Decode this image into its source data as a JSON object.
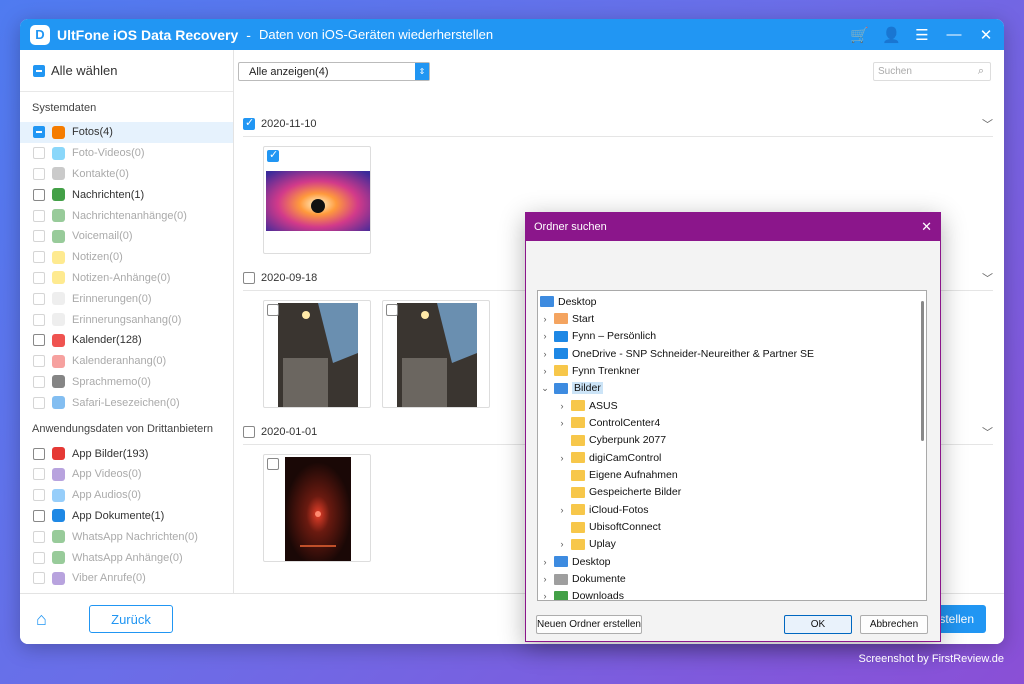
{
  "window": {
    "app_name": "UltFone iOS Data Recovery",
    "separator": "-",
    "subtitle": "Daten von iOS-Geräten wiederherstellen",
    "logo_letter": "D"
  },
  "sidebar": {
    "select_all": "Alle wählen",
    "section1_title": "Systemdaten",
    "section1_items": [
      {
        "label": "Fotos(4)",
        "state": "partial",
        "enabled": true,
        "active": true,
        "color": "#f57c00"
      },
      {
        "label": "Foto-Videos(0)",
        "state": "none",
        "enabled": false,
        "color": "#29b6f6"
      },
      {
        "label": "Kontakte(0)",
        "state": "none",
        "enabled": false,
        "color": "#9e9e9e"
      },
      {
        "label": "Nachrichten(1)",
        "state": "none",
        "enabled": true,
        "color": "#43a047"
      },
      {
        "label": "Nachrichtenanhänge(0)",
        "state": "none",
        "enabled": false,
        "color": "#43a047"
      },
      {
        "label": "Voicemail(0)",
        "state": "none",
        "enabled": false,
        "color": "#43a047"
      },
      {
        "label": "Notizen(0)",
        "state": "none",
        "enabled": false,
        "color": "#fdd835"
      },
      {
        "label": "Notizen-Anhänge(0)",
        "state": "none",
        "enabled": false,
        "color": "#fdd835"
      },
      {
        "label": "Erinnerungen(0)",
        "state": "none",
        "enabled": false,
        "color": "#e0e0e0"
      },
      {
        "label": "Erinnerungsanhang(0)",
        "state": "none",
        "enabled": false,
        "color": "#e0e0e0"
      },
      {
        "label": "Kalender(128)",
        "state": "none",
        "enabled": true,
        "color": "#ef5350"
      },
      {
        "label": "Kalenderanhang(0)",
        "state": "none",
        "enabled": false,
        "color": "#ef5350"
      },
      {
        "label": "Sprachmemo(0)",
        "state": "none",
        "enabled": false,
        "color": "#212121"
      },
      {
        "label": "Safari-Lesezeichen(0)",
        "state": "none",
        "enabled": false,
        "color": "#1e88e5"
      }
    ],
    "section2_title": "Anwendungsdaten von Drittanbietern",
    "section2_items": [
      {
        "label": "App Bilder(193)",
        "state": "none",
        "enabled": true,
        "color": "#e53935"
      },
      {
        "label": "App Videos(0)",
        "state": "none",
        "enabled": false,
        "color": "#7e57c2"
      },
      {
        "label": "App Audios(0)",
        "state": "none",
        "enabled": false,
        "color": "#42a5f5"
      },
      {
        "label": "App Dokumente(1)",
        "state": "none",
        "enabled": true,
        "color": "#1e88e5"
      },
      {
        "label": "WhatsApp Nachrichten(0)",
        "state": "none",
        "enabled": false,
        "color": "#43a047"
      },
      {
        "label": "WhatsApp Anhänge(0)",
        "state": "none",
        "enabled": false,
        "color": "#43a047"
      },
      {
        "label": "Viber Anrufe(0)",
        "state": "none",
        "enabled": false,
        "color": "#7e57c2"
      }
    ]
  },
  "toolbar": {
    "filter_value": "Alle anzeigen(4)",
    "search_placeholder": "Suchen"
  },
  "groups": [
    {
      "date": "2020-11-10",
      "checked": true
    },
    {
      "date": "2020-09-18",
      "checked": false
    },
    {
      "date": "2020-01-01",
      "checked": false
    }
  ],
  "footer": {
    "back_label": "Zurück",
    "restore_label": "stellen"
  },
  "dialog": {
    "title": "Ordner suchen",
    "tree": [
      {
        "label": "Desktop",
        "depth": 0,
        "expander": "",
        "icon": "#3d8be0"
      },
      {
        "label": "Start",
        "depth": 1,
        "expander": ">",
        "icon": "#f4a460"
      },
      {
        "label": "Fynn – Persönlich",
        "depth": 1,
        "expander": ">",
        "icon": "#1e88e5"
      },
      {
        "label": "OneDrive - SNP Schneider-Neureither & Partner SE",
        "depth": 1,
        "expander": ">",
        "icon": "#1e88e5"
      },
      {
        "label": "Fynn Trenkner",
        "depth": 1,
        "expander": ">",
        "icon": "#f7c74a"
      },
      {
        "label": "Bilder",
        "depth": 1,
        "expander": "v",
        "icon": "#3d8be0",
        "selected": true
      },
      {
        "label": "ASUS",
        "depth": 2,
        "expander": ">",
        "icon": "#f7c74a"
      },
      {
        "label": "ControlCenter4",
        "depth": 2,
        "expander": ">",
        "icon": "#f7c74a"
      },
      {
        "label": "Cyberpunk 2077",
        "depth": 2,
        "expander": "",
        "icon": "#f7c74a"
      },
      {
        "label": "digiCamControl",
        "depth": 2,
        "expander": ">",
        "icon": "#f7c74a"
      },
      {
        "label": "Eigene Aufnahmen",
        "depth": 2,
        "expander": "",
        "icon": "#f7c74a"
      },
      {
        "label": "Gespeicherte Bilder",
        "depth": 2,
        "expander": "",
        "icon": "#f7c74a"
      },
      {
        "label": "iCloud-Fotos",
        "depth": 2,
        "expander": ">",
        "icon": "#f7c74a"
      },
      {
        "label": "UbisoftConnect",
        "depth": 2,
        "expander": "",
        "icon": "#f7c74a"
      },
      {
        "label": "Uplay",
        "depth": 2,
        "expander": ">",
        "icon": "#f7c74a"
      },
      {
        "label": "Desktop",
        "depth": 1,
        "expander": ">",
        "icon": "#3d8be0"
      },
      {
        "label": "Dokumente",
        "depth": 1,
        "expander": ">",
        "icon": "#9e9e9e"
      },
      {
        "label": "Downloads",
        "depth": 1,
        "expander": ">",
        "icon": "#43a047"
      }
    ],
    "new_folder_label": "Neuen Ordner erstellen",
    "ok_label": "OK",
    "cancel_label": "Abbrechen"
  },
  "credit": "Screenshot by FirstReview.de"
}
